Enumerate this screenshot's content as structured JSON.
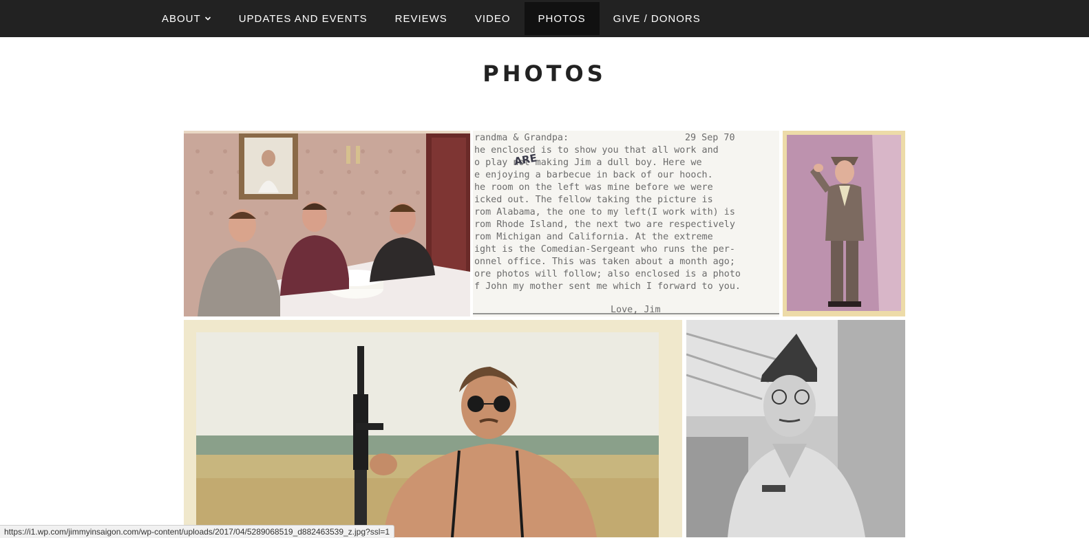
{
  "nav": {
    "items": [
      {
        "label": "ABOUT",
        "has_dropdown": true,
        "active": false
      },
      {
        "label": "UPDATES AND EVENTS",
        "has_dropdown": false,
        "active": false
      },
      {
        "label": "REVIEWS",
        "has_dropdown": false,
        "active": false
      },
      {
        "label": "VIDEO",
        "has_dropdown": false,
        "active": false
      },
      {
        "label": "PHOTOS",
        "has_dropdown": false,
        "active": true
      },
      {
        "label": "GIVE / DONORS",
        "has_dropdown": false,
        "active": false
      }
    ]
  },
  "page": {
    "title": "PHOTOS"
  },
  "letter": {
    "date": "29 Sep 70",
    "correction": "ARE",
    "signature": "Love, Jim",
    "lines": [
      "randma & Grandpa:",
      "he enclosed is to show you that all work and",
      "o play     not making Jim a dull boy.  Here we",
      "e enjoying a barbecue in back of our hooch.",
      "he room on the left was mine before we were",
      "icked out.  The fellow taking the picture is",
      "rom Alabama, the one to my left(I work with) is",
      "rom Rhode Island, the next two are respectively",
      "rom Michigan and California.  At the extreme",
      "ight is the Comedian-Sergeant who runs the per-",
      "onnel office.  This was taken about a month ago;",
      "ore photos will follow; also enclosed is a photo",
      "f John my mother sent me which I forward to you."
    ]
  },
  "status_bar": {
    "url": "https://i1.wp.com/jimmyinsaigon.com/wp-content/uploads/2017/04/5289068519_d882463539_z.jpg?ssl=1"
  },
  "colors": {
    "nav_bg": "#222222",
    "nav_active_bg": "#111111",
    "nav_text": "#ffffff",
    "title_text": "#222222"
  }
}
